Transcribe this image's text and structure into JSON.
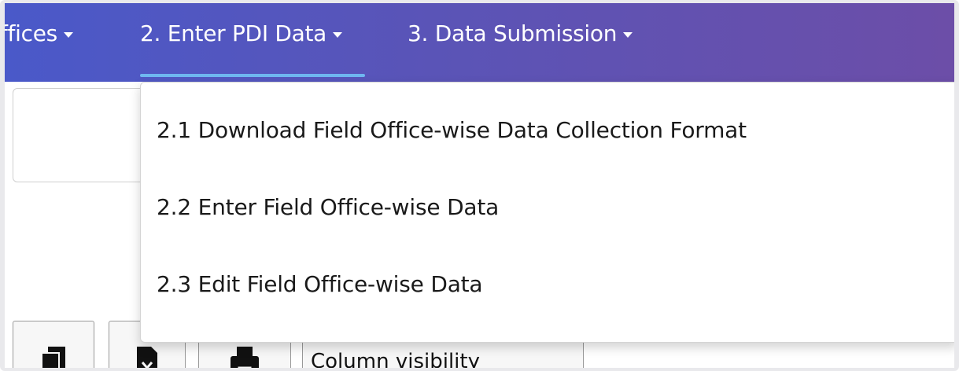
{
  "navbar": {
    "items": [
      {
        "label": "ffices"
      },
      {
        "label": "2. Enter PDI Data"
      },
      {
        "label": "3. Data Submission"
      }
    ]
  },
  "dropdown": {
    "items": [
      {
        "label": "2.1  Download Field Office-wise Data Collection Format"
      },
      {
        "label": "2.2  Enter Field Office-wise Data"
      },
      {
        "label": "2.3  Edit Field Office-wise Data"
      }
    ]
  },
  "toolbar": {
    "buttons": [
      {
        "icon": "copy-icon"
      },
      {
        "icon": "excel-icon"
      },
      {
        "icon": "print-icon"
      },
      {
        "label": "Column visibility"
      }
    ]
  },
  "colors": {
    "navbar_gradient_start": "#4a59c9",
    "navbar_gradient_end": "#6c4ea8",
    "active_underline": "#6fb7f0"
  }
}
